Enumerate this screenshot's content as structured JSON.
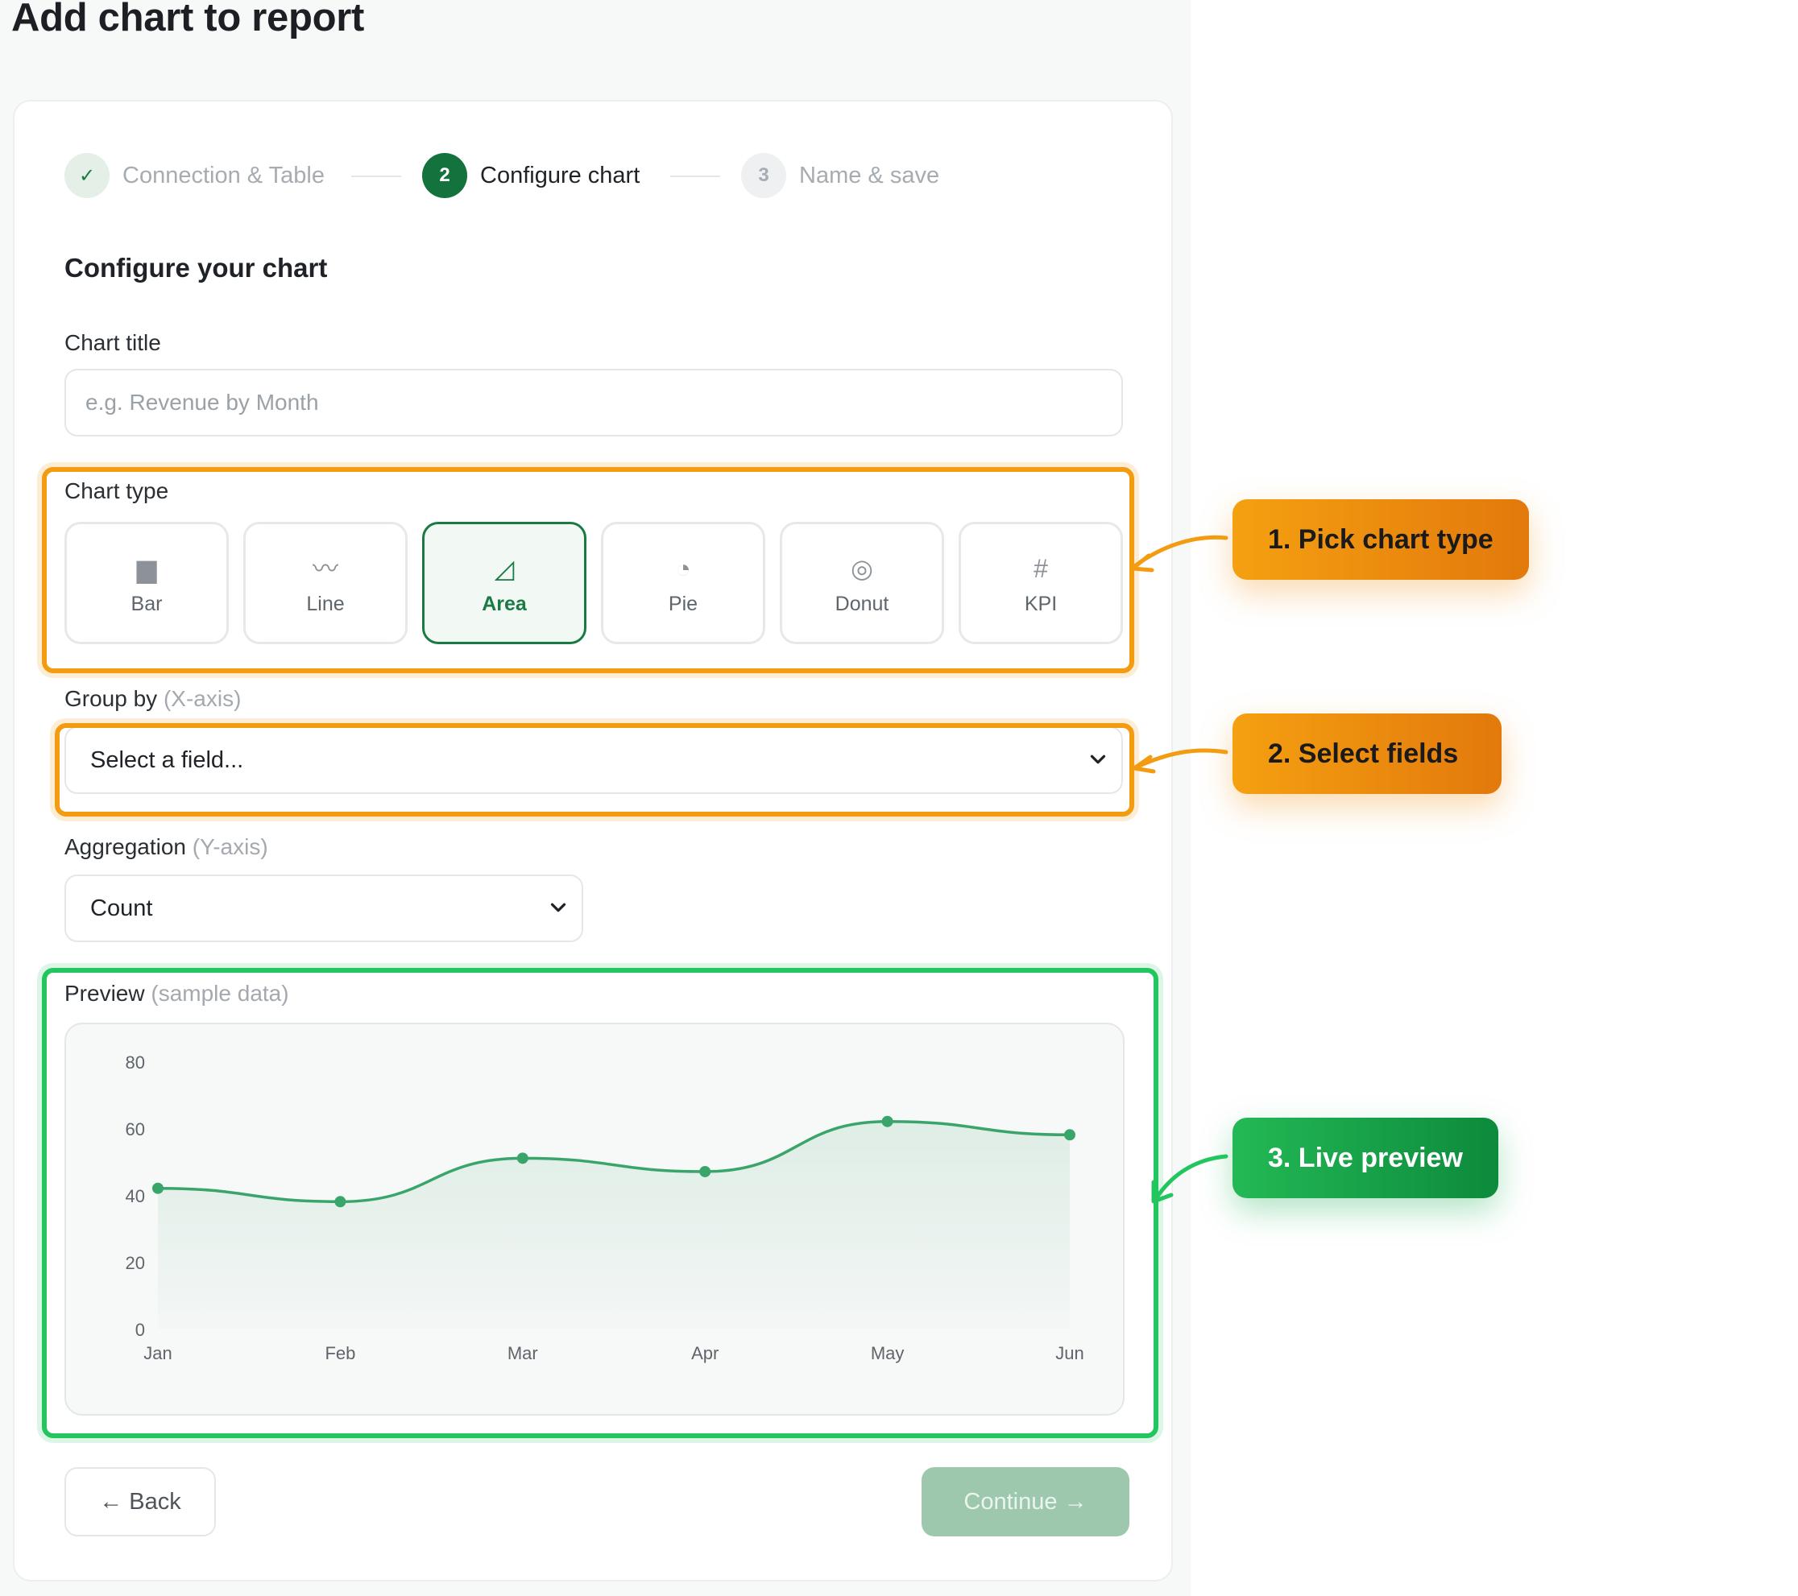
{
  "page": {
    "title": "Add chart to report"
  },
  "stepper": {
    "steps": [
      {
        "number": "✓",
        "label": "Connection & Table",
        "state": "done"
      },
      {
        "number": "2",
        "label": "Configure chart",
        "state": "active"
      },
      {
        "number": "3",
        "label": "Name & save",
        "state": "pending"
      }
    ]
  },
  "form": {
    "heading": "Configure your chart",
    "chart_title": {
      "label": "Chart title",
      "value": "",
      "placeholder": "e.g. Revenue by Month"
    },
    "chart_type": {
      "label": "Chart type",
      "selected": "Area",
      "options": [
        {
          "name": "Bar",
          "icon": "bar-icon",
          "glyph": "▆"
        },
        {
          "name": "Line",
          "icon": "line-icon",
          "glyph": "〰"
        },
        {
          "name": "Area",
          "icon": "area-icon",
          "glyph": "◿"
        },
        {
          "name": "Pie",
          "icon": "pie-icon",
          "glyph": "◔"
        },
        {
          "name": "Donut",
          "icon": "donut-icon",
          "glyph": "◎"
        },
        {
          "name": "KPI",
          "icon": "kpi-icon",
          "glyph": "#"
        }
      ]
    },
    "group_by": {
      "label": "Group by",
      "hint": "(X-axis)",
      "value": "Select a field..."
    },
    "aggregation": {
      "label": "Aggregation",
      "hint": "(Y-axis)",
      "value": "Count"
    },
    "preview": {
      "label": "Preview",
      "hint": "(sample data)"
    }
  },
  "chart_data": {
    "type": "area",
    "categories": [
      "Jan",
      "Feb",
      "Mar",
      "Apr",
      "May",
      "Jun"
    ],
    "values": [
      42,
      38,
      51,
      47,
      62,
      58
    ],
    "ylim": [
      0,
      80
    ],
    "yticks": [
      0,
      20,
      40,
      60,
      80
    ],
    "grid": false,
    "color": "#3aa56b"
  },
  "actions": {
    "back": "← Back",
    "continue": "Continue →"
  },
  "annotations": [
    {
      "text": "1. Pick chart type",
      "style": "orange"
    },
    {
      "text": "2. Select fields",
      "style": "orange"
    },
    {
      "text": "3. Live preview",
      "style": "green"
    }
  ],
  "colors": {
    "brand_green": "#1a7a44",
    "callout_orange": "#f39c12",
    "callout_green": "#22c55e",
    "continue_disabled": "#9ec8ad"
  }
}
